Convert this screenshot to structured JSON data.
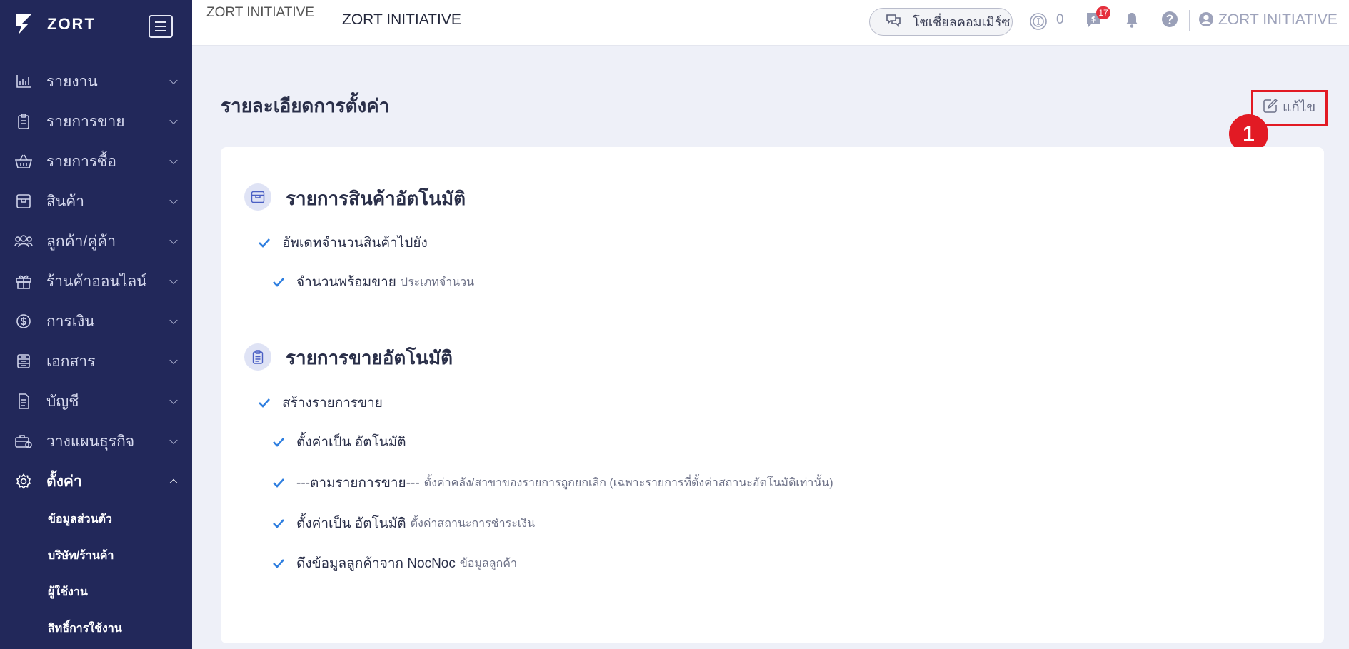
{
  "brand": {
    "name": "ZORT"
  },
  "sidebar": {
    "items": [
      {
        "label": "รายงาน",
        "icon": "bar-chart-icon"
      },
      {
        "label": "รายการขาย",
        "icon": "clipboard-icon"
      },
      {
        "label": "รายการซื้อ",
        "icon": "basket-icon"
      },
      {
        "label": "สินค้า",
        "icon": "box-icon"
      },
      {
        "label": "ลูกค้า/คู่ค้า",
        "icon": "users-icon"
      },
      {
        "label": "ร้านค้าออนไลน์",
        "icon": "gift-icon"
      },
      {
        "label": "การเงิน",
        "icon": "dollar-circle-icon"
      },
      {
        "label": "เอกสาร",
        "icon": "document-icon"
      },
      {
        "label": "บัญชี",
        "icon": "ledger-icon"
      },
      {
        "label": "วางแผนธุรกิจ",
        "icon": "briefcase-icon"
      },
      {
        "label": "ตั้งค่า",
        "icon": "gear-icon",
        "active": true
      }
    ],
    "subitems": [
      "ข้อมูลส่วนตัว",
      "บริษัท/ร้านค้า",
      "ผู้ใช้งาน",
      "สิทธิ์การใช้งาน"
    ]
  },
  "header": {
    "company_img_alt": "ZORT INITIATIVE",
    "company_name": "ZORT INITIATIVE",
    "social_commerce_label": "โซเชี่ยลคอมเมิร์ซ",
    "credit_count": "0",
    "message_badge": "17",
    "user_name": "ZORT INITIATIVE"
  },
  "main": {
    "title": "รายละเอียดการตั้งค่า",
    "edit_label": "แก้ไข",
    "step_marker": "1",
    "sections": [
      {
        "title": "รายการสินค้าอัตโนมัติ",
        "icon": "box-icon",
        "rows": [
          {
            "main": "อัพเดทจำนวนสินค้าไปยัง",
            "sub": ""
          },
          {
            "main": "จำนวนพร้อมขาย",
            "sub": "ประเภทจำนวน"
          }
        ]
      },
      {
        "title": "รายการขายอัตโนมัติ",
        "icon": "clipboard-icon",
        "rows": [
          {
            "main": "สร้างรายการขาย",
            "sub": ""
          },
          {
            "main": "ตั้งค่าเป็น อัตโนมัติ",
            "sub": ""
          },
          {
            "main": "---ตามรายการขาย---",
            "sub": "ตั้งค่าคลัง/สาขาของรายการถูกยกเลิก (เฉพาะรายการที่ตั้งค่าสถานะอัตโนมัติเท่านั้น)"
          },
          {
            "main": "ตั้งค่าเป็น อัตโนมัติ",
            "sub": "ตั้งค่าสถานะการชำระเงิน"
          },
          {
            "main": "ดึงข้อมูลลูกค้าจาก NocNoc",
            "sub": "ข้อมูลลูกค้า"
          }
        ]
      }
    ]
  },
  "colors": {
    "sidebar": "#22285a",
    "accent": "#2f7fe0",
    "highlight": "#e21a24",
    "background": "#eef0f8"
  }
}
